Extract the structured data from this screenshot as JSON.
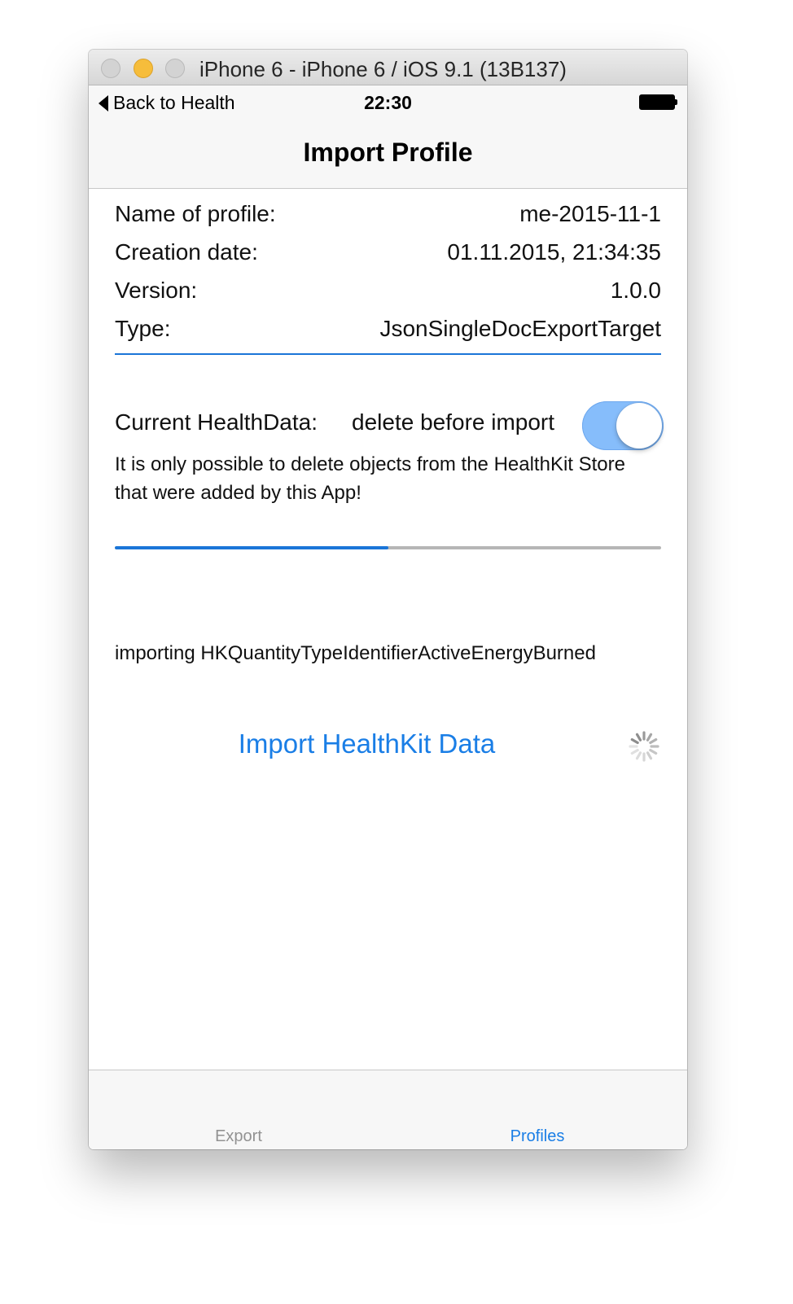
{
  "window": {
    "title": "iPhone 6 - iPhone 6 / iOS 9.1 (13B137)"
  },
  "statusbar": {
    "back_label": "Back to Health",
    "time": "22:30"
  },
  "nav": {
    "title": "Import Profile"
  },
  "profile": {
    "rows": [
      {
        "label": "Name of profile:",
        "value": "me-2015-11-1"
      },
      {
        "label": "Creation date:",
        "value": "01.11.2015, 21:34:35"
      },
      {
        "label": "Version:",
        "value": "1.0.0"
      },
      {
        "label": "Type:",
        "value": "JsonSingleDocExportTarget"
      }
    ]
  },
  "healthdata": {
    "label": "Current HealthData:",
    "option": "delete before import",
    "toggle_on": true,
    "hint": "It is only possible to delete objects from the HealthKit Store  that were added by this App!"
  },
  "progress": {
    "fraction": 0.5
  },
  "status": {
    "text": "importing HKQuantityTypeIdentifierActiveEnergyBurned"
  },
  "actions": {
    "import_label": "Import HealthKit Data"
  },
  "tabs": [
    {
      "label": "Export",
      "selected": false
    },
    {
      "label": "Profiles",
      "selected": true
    }
  ],
  "colors": {
    "accent": "#1a7ee6",
    "toggle_on": "#86bdfb",
    "progress_track": "#b6b6b6"
  }
}
